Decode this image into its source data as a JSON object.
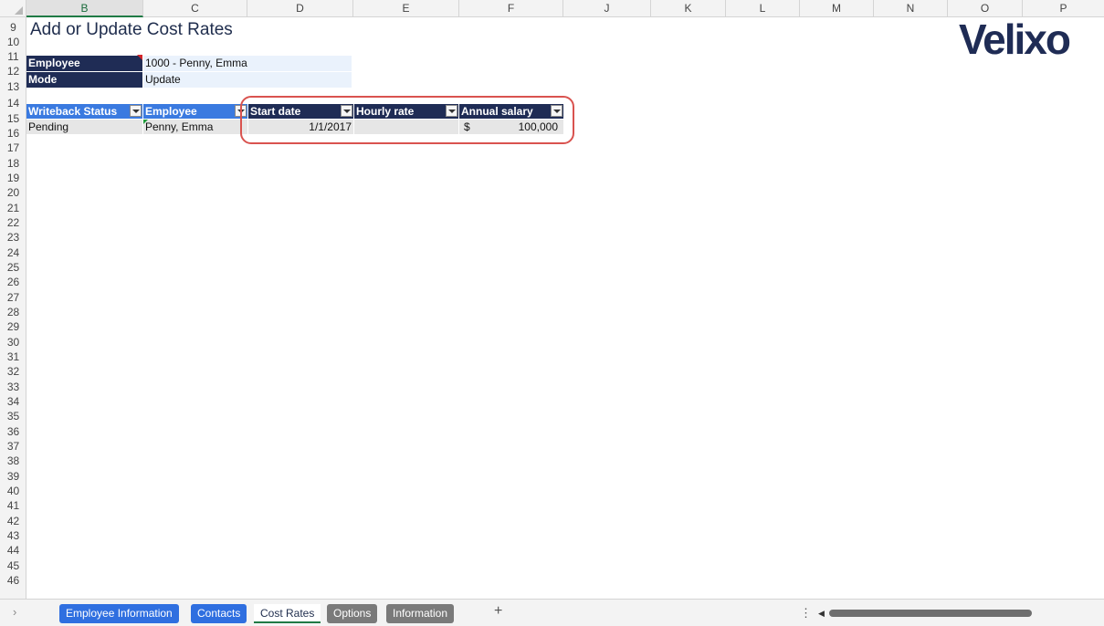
{
  "columns": [
    "B",
    "C",
    "D",
    "E",
    "F",
    "J",
    "K",
    "L",
    "M",
    "N",
    "O",
    "P"
  ],
  "rows": [
    "9",
    "10",
    "11",
    "12",
    "13",
    "14",
    "15",
    "16",
    "17",
    "18",
    "19",
    "20",
    "21",
    "22",
    "23",
    "24",
    "25",
    "26",
    "27",
    "28",
    "29",
    "30",
    "31",
    "32",
    "33",
    "34",
    "35",
    "36",
    "37",
    "38",
    "39",
    "40",
    "41",
    "42",
    "43",
    "44",
    "45",
    "46"
  ],
  "sheet": {
    "title": "Add or Update Cost Rates",
    "logo_text": "Velixo",
    "params": {
      "employee_label": "Employee",
      "employee_value": "1000 - Penny, Emma",
      "mode_label": "Mode",
      "mode_value": "Update"
    },
    "table": {
      "headers": [
        "Writeback Status",
        "Employee",
        "Start date",
        "Hourly rate",
        "Annual salary"
      ],
      "row": {
        "status": "Pending",
        "employee": "Penny, Emma",
        "start_date": "1/1/2017",
        "hourly_rate": "",
        "currency": "$",
        "annual_salary": "100,000"
      }
    }
  },
  "tabs": [
    "Employee Information",
    "Contacts",
    "Cost Rates",
    "Options",
    "Information"
  ],
  "add_tab_label": "+",
  "colors": {
    "navy": "#1f2c55",
    "blue": "#3a7ae0",
    "highlight": "#d9534f"
  }
}
